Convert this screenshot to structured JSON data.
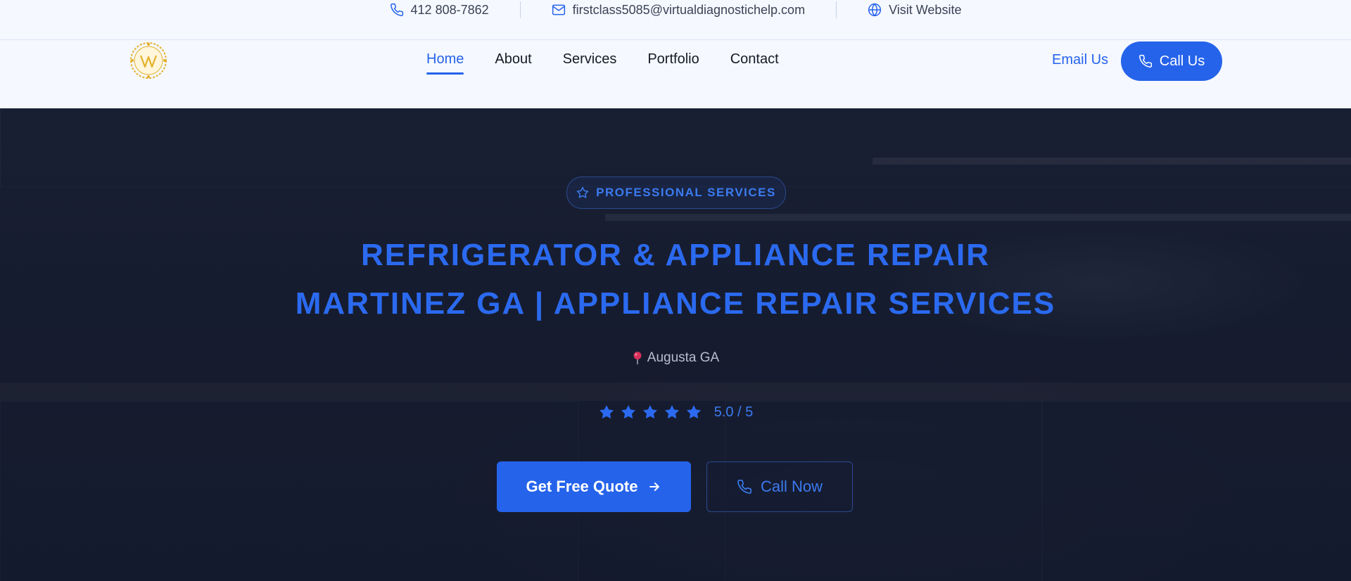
{
  "topbar": {
    "phone": "412 808-7862",
    "email": "firstclass5085@virtualdiagnostichelp.com",
    "website": "Visit Website"
  },
  "nav": {
    "links": [
      {
        "label": "Home",
        "active": true
      },
      {
        "label": "About",
        "active": false
      },
      {
        "label": "Services",
        "active": false
      },
      {
        "label": "Portfolio",
        "active": false
      },
      {
        "label": "Contact",
        "active": false
      }
    ],
    "email_label": "Email Us",
    "call_label": "Call Us"
  },
  "hero": {
    "badge": "PROFESSIONAL SERVICES",
    "title_line1": "REFRIGERATOR & APPLIANCE REPAIR",
    "title_line2": "MARTINEZ GA | APPLIANCE REPAIR SERVICES",
    "location": "Augusta GA",
    "rating_stars": 5,
    "rating_text": "5.0 / 5",
    "quote_button": "Get Free Quote",
    "call_button": "Call Now"
  },
  "colors": {
    "accent": "#2563eb",
    "hero_bg": "#1b2131",
    "logo_gold": "#e3b12a"
  },
  "icons": {
    "phone": "phone-icon",
    "email": "mail-icon",
    "website": "globe-icon",
    "badge": "star-outline-icon",
    "location": "map-pin-icon",
    "quote_arrow": "arrow-right-icon"
  }
}
